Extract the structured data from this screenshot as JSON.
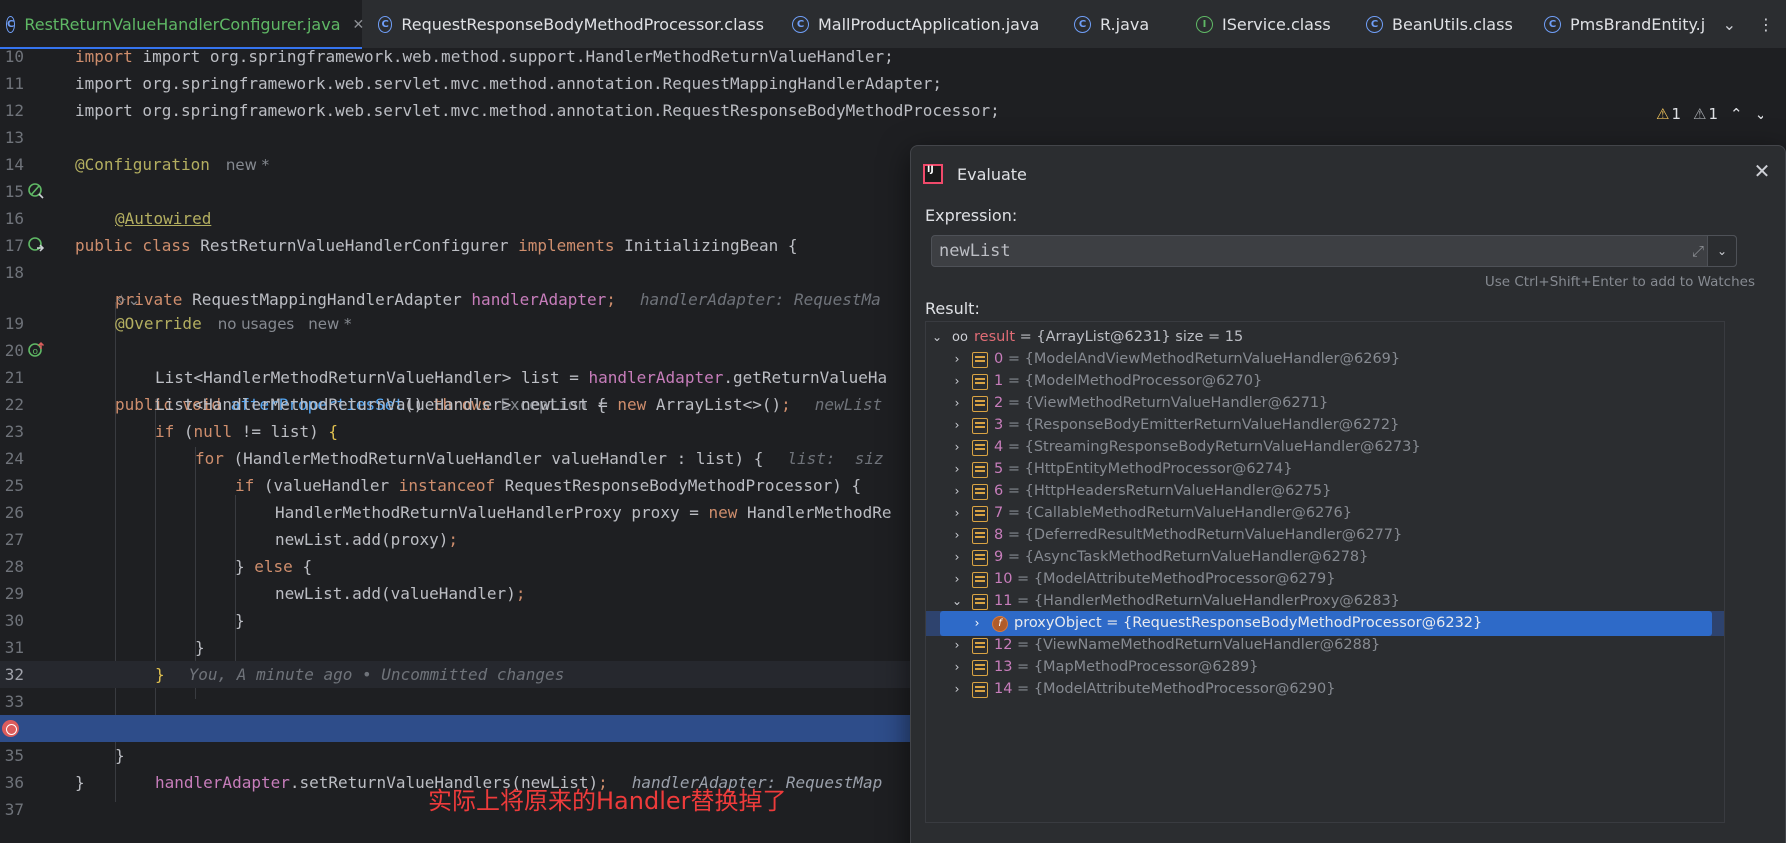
{
  "tabs": [
    {
      "label": "RestReturnValueHandlerConfigurer.java",
      "active": true,
      "icon": "class-icon"
    },
    {
      "label": "RequestResponseBodyMethodProcessor.class",
      "active": false,
      "icon": "class-icon"
    },
    {
      "label": "MallProductApplication.java",
      "active": false,
      "icon": "class-icon"
    },
    {
      "label": "R.java",
      "active": false,
      "icon": "class-icon"
    },
    {
      "label": "IService.class",
      "active": false,
      "icon": "interface-icon"
    },
    {
      "label": "BeanUtils.class",
      "active": false,
      "icon": "class-icon"
    },
    {
      "label": "PmsBrandEntity.j",
      "active": false,
      "icon": "class-icon"
    }
  ],
  "indicators": {
    "warnings": "1",
    "weak_warnings": "1"
  },
  "code": {
    "l10_num": "10",
    "l10": "import org.springframework.web.method.support.HandlerMethodReturnValueHandler;",
    "l11_num": "11",
    "l11": "import org.springframework.web.servlet.mvc.method.annotation.RequestMappingHandlerAdapter;",
    "l12_num": "12",
    "l12": "import org.springframework.web.servlet.mvc.method.annotation.RequestResponseBodyMethodProcessor;",
    "l13_num": "13",
    "l14_num": "14",
    "l14_ann": "@Configuration",
    "l14_hint": "new *",
    "l15_num": "15",
    "l15_kw": "public class ",
    "l15_cls": "RestReturnValueHandlerConfigurer ",
    "l15_kw2": "implements ",
    "l15_rest": "InitializingBean {",
    "l16_num": "16",
    "l16_ann": "@Autowired",
    "l17_num": "17",
    "l17_kw": "private ",
    "l17_type": "RequestMappingHandlerAdapter ",
    "l17_fld": "handlerAdapter",
    "l17_semi": ";",
    "l17_hint": "handlerAdapter: RequestMa",
    "l18_num": "18",
    "l19_num": "19",
    "l19_ann": "@Override",
    "l19_hint1": "no usages",
    "l19_hint2": "new *",
    "l20_num": "20",
    "l20_kw": "public void ",
    "l20_fn": "afterPropertiesSet",
    "l20_p": "() ",
    "l20_kw2": "throws ",
    "l20_ex": "Exception",
    "l20_b": " {",
    "l21_num": "21",
    "l21_a": "List<HandlerMethodReturnValueHandler> list = ",
    "l21_fld": "handlerAdapter",
    "l21_b": ".getReturnValueHa",
    "l22_num": "22",
    "l22_a": "List<HandlerMethodReturnValueHandler> newList = ",
    "l22_kw": "new ",
    "l22_b": "ArrayList<>()",
    "l22_semi": ";",
    "l22_hint": "newList",
    "l23_num": "23",
    "l23_kw": "if ",
    "l23_a": "(",
    "l23_kw2": "null ",
    "l23_b": "!= list) ",
    "l23_brace": "{",
    "l24_num": "24",
    "l24_kw": "for ",
    "l24_a": "(HandlerMethodReturnValueHandler valueHandler : list) {",
    "l24_hint": "list:  siz",
    "l25_num": "25",
    "l25_kw": "if ",
    "l25_a": "(valueHandler ",
    "l25_kw2": "instanceof ",
    "l25_b": "RequestResponseBodyMethodProcessor) {",
    "l26_num": "26",
    "l26_a": "HandlerMethodReturnValueHandlerProxy proxy = ",
    "l26_kw": "new ",
    "l26_b": "HandlerMethodRe",
    "l27_num": "27",
    "l27_a": "newList.add(proxy)",
    "l27_semi": ";",
    "l28_num": "28",
    "l28_a": "} ",
    "l28_kw": "else ",
    "l28_b": "{",
    "l29_num": "29",
    "l29_a": "newList.add(valueHandler)",
    "l29_semi": ";",
    "l30_num": "30",
    "l30_a": "}",
    "l31_num": "31",
    "l31_a": "}",
    "l32_num": "32",
    "l32_brace": "}",
    "l32_hint": "You, A minute ago • Uncommitted changes",
    "l33_num": "33",
    "l34_fld": "handlerAdapter",
    "l34_a": ".setReturnValueHandlers(newList)",
    "l34_semi": ";",
    "l34_hint": "handlerAdapter: RequestMap",
    "l35_num": "35",
    "l35_a": "}",
    "l36_num": "36",
    "l36_a": "}",
    "l37_num": "37"
  },
  "annotation": "实际上将原来的Handler替换掉了",
  "dialog": {
    "title": "Evaluate",
    "expression_label": "Expression:",
    "expression_value": "newList",
    "tip": "Use Ctrl+Shift+Enter to add to Watches",
    "result_label": "Result:",
    "result_head": {
      "name": "result",
      "text": " = {ArrayList@6231}  size = 15"
    },
    "items": [
      {
        "idx": "0",
        "text": " = {ModelAndViewMethodReturnValueHandler@6269}"
      },
      {
        "idx": "1",
        "text": " = {ModelMethodProcessor@6270}"
      },
      {
        "idx": "2",
        "text": " = {ViewMethodReturnValueHandler@6271}"
      },
      {
        "idx": "3",
        "text": " = {ResponseBodyEmitterReturnValueHandler@6272}"
      },
      {
        "idx": "4",
        "text": " = {StreamingResponseBodyReturnValueHandler@6273}"
      },
      {
        "idx": "5",
        "text": " = {HttpEntityMethodProcessor@6274}"
      },
      {
        "idx": "6",
        "text": " = {HttpHeadersReturnValueHandler@6275}"
      },
      {
        "idx": "7",
        "text": " = {CallableMethodReturnValueHandler@6276}"
      },
      {
        "idx": "8",
        "text": " = {DeferredResultMethodReturnValueHandler@6277}"
      },
      {
        "idx": "9",
        "text": " = {AsyncTaskMethodReturnValueHandler@6278}"
      },
      {
        "idx": "10",
        "text": " = {ModelAttributeMethodProcessor@6279}"
      },
      {
        "idx": "11",
        "text": " = {HandlerMethodReturnValueHandlerProxy@6283}"
      }
    ],
    "child": {
      "name": "proxyObject",
      "text": " = {RequestResponseBodyMethodProcessor@6232}"
    },
    "items_after": [
      {
        "idx": "12",
        "text": " = {ViewNameMethodReturnValueHandler@6288}"
      },
      {
        "idx": "13",
        "text": " = {MapMethodProcessor@6289}"
      },
      {
        "idx": "14",
        "text": " = {ModelAttributeMethodProcessor@6290}"
      }
    ]
  }
}
